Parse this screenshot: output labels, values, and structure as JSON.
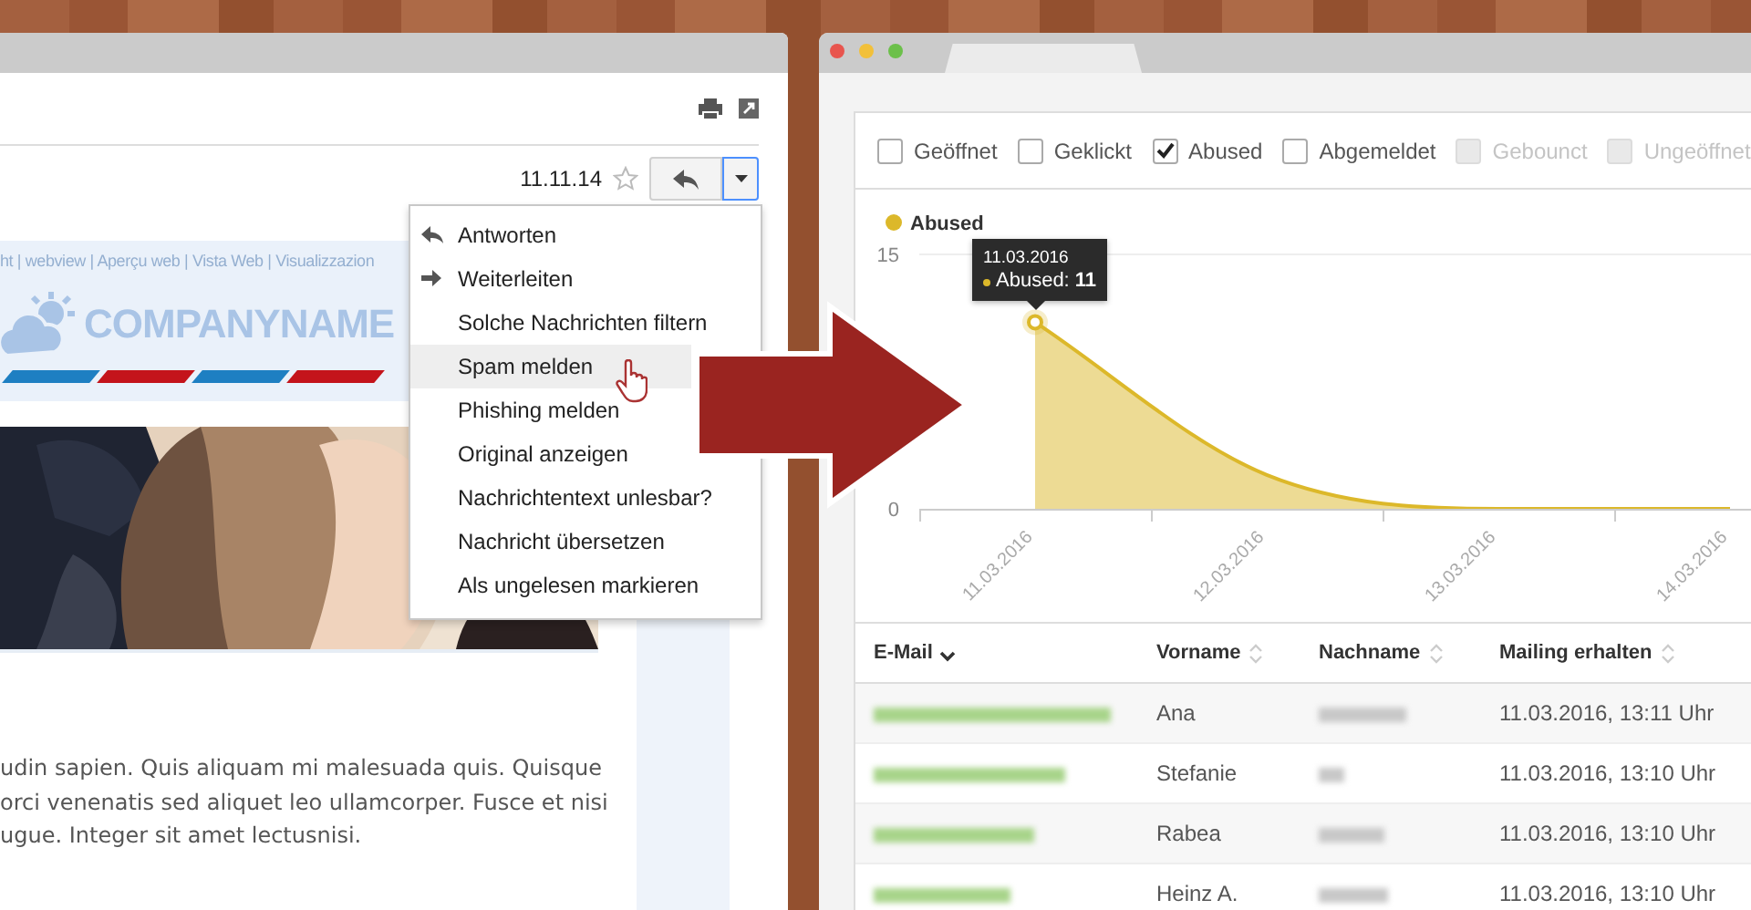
{
  "left_window": {
    "date": "11.11.14",
    "starred": false,
    "email": {
      "links": "ht | webview | Aperçu web | Vista Web | Visualizzazion",
      "logo": "COMPANYNAME",
      "photo": {
        "kind": "picture"
      },
      "body_lines": [
        "udin sapien. Quis aliquam mi malesuada quis. Quisque",
        "orci venenatis sed aliquet leo ullamcorper. Fusce et nisi",
        "ugue. Integer sit amet lectusnisi."
      ]
    },
    "menu": [
      {
        "label": "Antworten",
        "kind": "reply",
        "selected": false
      },
      {
        "label": "Weiterleiten",
        "kind": "forward",
        "selected": false
      },
      {
        "label": "Solche Nachrichten filtern",
        "selected": false
      },
      {
        "label": "Spam melden",
        "selected": true
      },
      {
        "label": "Phishing melden",
        "selected": false
      },
      {
        "label": "Original anzeigen",
        "selected": false
      },
      {
        "label": "Nachrichtentext unlesbar?",
        "selected": false
      },
      {
        "label": "Nachricht übersetzen",
        "selected": false
      },
      {
        "label": "Als ungelesen markieren",
        "selected": false
      }
    ]
  },
  "right_window": {
    "filters": [
      {
        "label": "Geöffnet",
        "checked": false,
        "disabled": false
      },
      {
        "label": "Geklickt",
        "checked": false,
        "disabled": false
      },
      {
        "label": "Abused",
        "checked": true,
        "disabled": false
      },
      {
        "label": "Abgemeldet",
        "checked": false,
        "disabled": false
      },
      {
        "label": "Gebounct",
        "checked": false,
        "disabled": true
      },
      {
        "label": "Ungeöffnet",
        "checked": false,
        "disabled": true
      }
    ],
    "chart_data": {
      "type": "area",
      "categories": [
        "11.03.2016",
        "12.03.2016",
        "13.03.2016",
        "14.03.2016"
      ],
      "yticks": [
        0,
        15
      ],
      "ylim": [
        0,
        15
      ],
      "series": [
        {
          "name": "Abused",
          "color": "#dcb82a",
          "values": [
            11,
            2,
            0,
            0
          ]
        }
      ]
    },
    "tooltip": {
      "date": "11.03.2016",
      "text": "Abused: **11**"
    },
    "table": {
      "columns": [
        {
          "label": "E-Mail",
          "sorted": true
        },
        {
          "label": "Vorname",
          "sorted": false
        },
        {
          "label": "Nachname",
          "sorted": false
        },
        {
          "label": "Mailing erhalten",
          "sorted": false
        }
      ],
      "rows": [
        {
          "vorname": "Ana",
          "received": "11.03.2016, 13:11 Uhr"
        },
        {
          "vorname": "Stefanie",
          "received": "11.03.2016, 13:10 Uhr"
        },
        {
          "vorname": "Rabea",
          "received": "11.03.2016, 13:10 Uhr"
        },
        {
          "vorname": "Heinz A.",
          "received": "11.03.2016, 13:10 Uhr"
        }
      ]
    }
  }
}
